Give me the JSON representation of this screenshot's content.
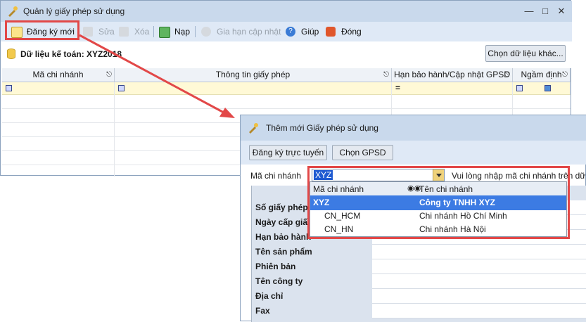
{
  "main_window": {
    "title": "Quản lý giấy phép sử dụng",
    "toolbar": {
      "register": "Đăng ký mới",
      "edit": "Sửa",
      "delete": "Xóa",
      "reload": "Nạp",
      "extend": "Gia hạn cập nhật",
      "help": "Giúp",
      "close": "Đóng"
    },
    "data_label": "Dữ liệu kế toán: XYZ2018",
    "choose_data_button": "Chọn dữ liệu khác...",
    "grid": {
      "columns": [
        "Mã chi nhánh",
        "Thông tin giấy phép",
        "Hạn bảo hành/Cập nhật GPSD",
        "Ngầm định"
      ],
      "filter_eq": "="
    }
  },
  "dialog": {
    "title": "Thêm mới Giấy phép sử dụng",
    "buttons": {
      "register_online": "Đăng ký trực tuyến",
      "choose": "Chọn GPSD"
    },
    "branch_label": "Mã chi nhánh",
    "branch_value": "XYZ",
    "hint": "Vui lòng nhập mã chi nhánh trên dữ liệ",
    "fields": [
      "Số giấy phép",
      "Ngày cấp giấy",
      "Hạn bảo hành",
      "Tên sản phẩm",
      "Phiên bản",
      "Tên công ty",
      "Địa chỉ",
      "Fax"
    ]
  },
  "dropdown": {
    "headers": [
      "Mã chi nhánh",
      "Tên chi nhánh"
    ],
    "rows": [
      {
        "code": "XYZ",
        "name": "Công ty TNHH XYZ"
      },
      {
        "code": "CN_HCM",
        "name": "Chi nhánh Hồ Chí Minh"
      },
      {
        "code": "CN_HN",
        "name": "Chi nhánh Hà Nội"
      }
    ]
  },
  "colors": {
    "highlight": "#e24848",
    "selection": "#3c7be3",
    "titlebar": "#c9d9ec"
  }
}
